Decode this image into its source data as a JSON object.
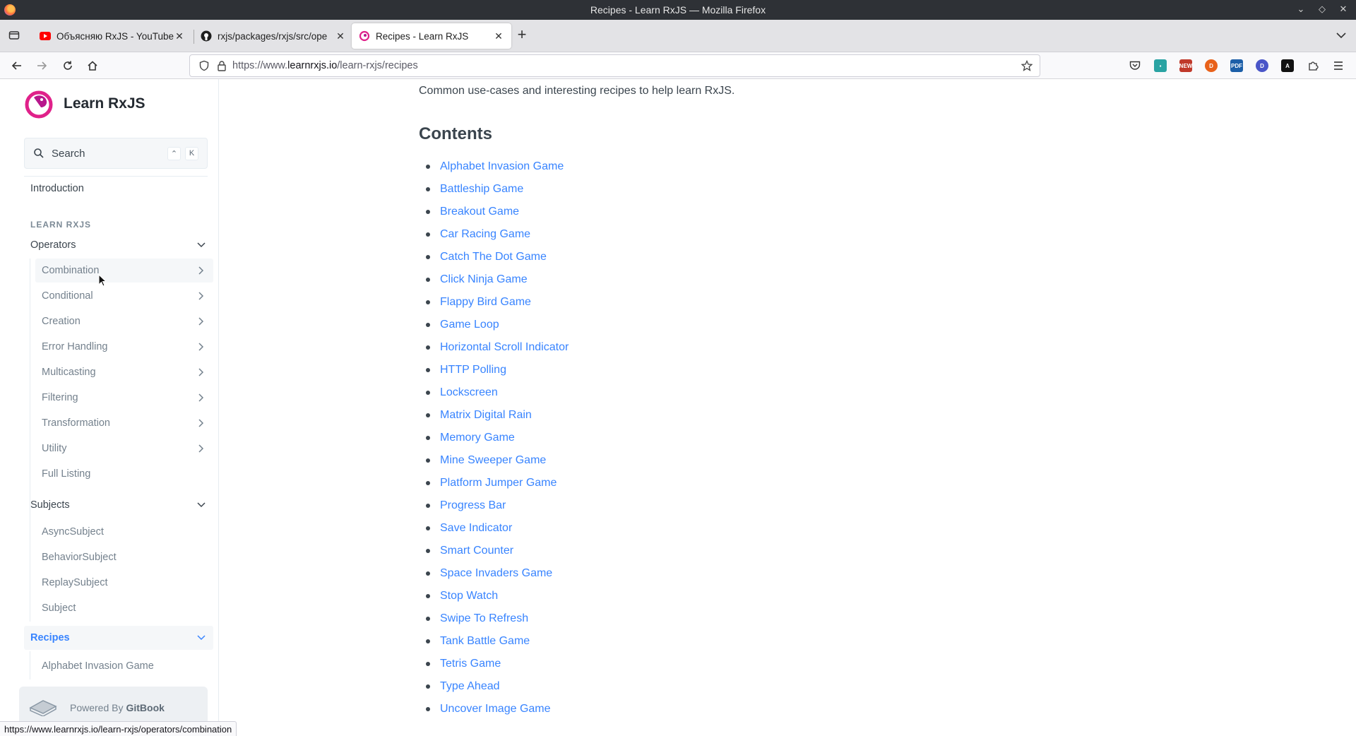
{
  "window": {
    "title": "Recipes - Learn RxJS — Mozilla Firefox"
  },
  "tabs": [
    {
      "label": "Объясняю RxJS - YouTube",
      "favicon": "youtube-icon"
    },
    {
      "label": "rxjs/packages/rxjs/src/ope",
      "favicon": "github-icon"
    },
    {
      "label": "Recipes - Learn RxJS",
      "favicon": "learnrxjs-icon",
      "active": true
    }
  ],
  "address_bar": {
    "url_prefix": "https://www.",
    "url_domain": "learnrxjs.io",
    "url_path": "/learn-rxjs/recipes"
  },
  "sidebar": {
    "brand": "Learn RxJS",
    "search": {
      "placeholder": "Search",
      "key1": "⌃",
      "key2": "K"
    },
    "introduction": "Introduction",
    "section_title": "LEARN RXJS",
    "operators": {
      "label": "Operators",
      "items": [
        "Combination",
        "Conditional",
        "Creation",
        "Error Handling",
        "Multicasting",
        "Filtering",
        "Transformation",
        "Utility",
        "Full Listing"
      ]
    },
    "subjects": {
      "label": "Subjects",
      "items": [
        "AsyncSubject",
        "BehaviorSubject",
        "ReplaySubject",
        "Subject"
      ]
    },
    "recipes": {
      "label": "Recipes",
      "items": [
        "Alphabet Invasion Game"
      ]
    },
    "powered_by": {
      "prefix": "Powered By",
      "brand": "GitBook"
    }
  },
  "content": {
    "lead": "Common use-cases and interesting recipes to help learn RxJS.",
    "heading": "Contents",
    "recipes": [
      "Alphabet Invasion Game",
      "Battleship Game",
      "Breakout Game",
      "Car Racing Game",
      "Catch The Dot Game",
      "Click Ninja Game",
      "Flappy Bird Game",
      "Game Loop",
      "Horizontal Scroll Indicator",
      "HTTP Polling",
      "Lockscreen",
      "Matrix Digital Rain",
      "Memory Game",
      "Mine Sweeper Game",
      "Platform Jumper Game",
      "Progress Bar",
      "Save Indicator",
      "Smart Counter",
      "Space Invaders Game",
      "Stop Watch",
      "Swipe To Refresh",
      "Tank Battle Game",
      "Tetris Game",
      "Type Ahead",
      "Uncover Image Game"
    ]
  },
  "status_bar": {
    "url": "https://www.learnrxjs.io/learn-rxjs/operators/combination"
  },
  "colors": {
    "link": "#3884ff",
    "text": "#3b454e",
    "brand_logo": "#e0218a"
  }
}
